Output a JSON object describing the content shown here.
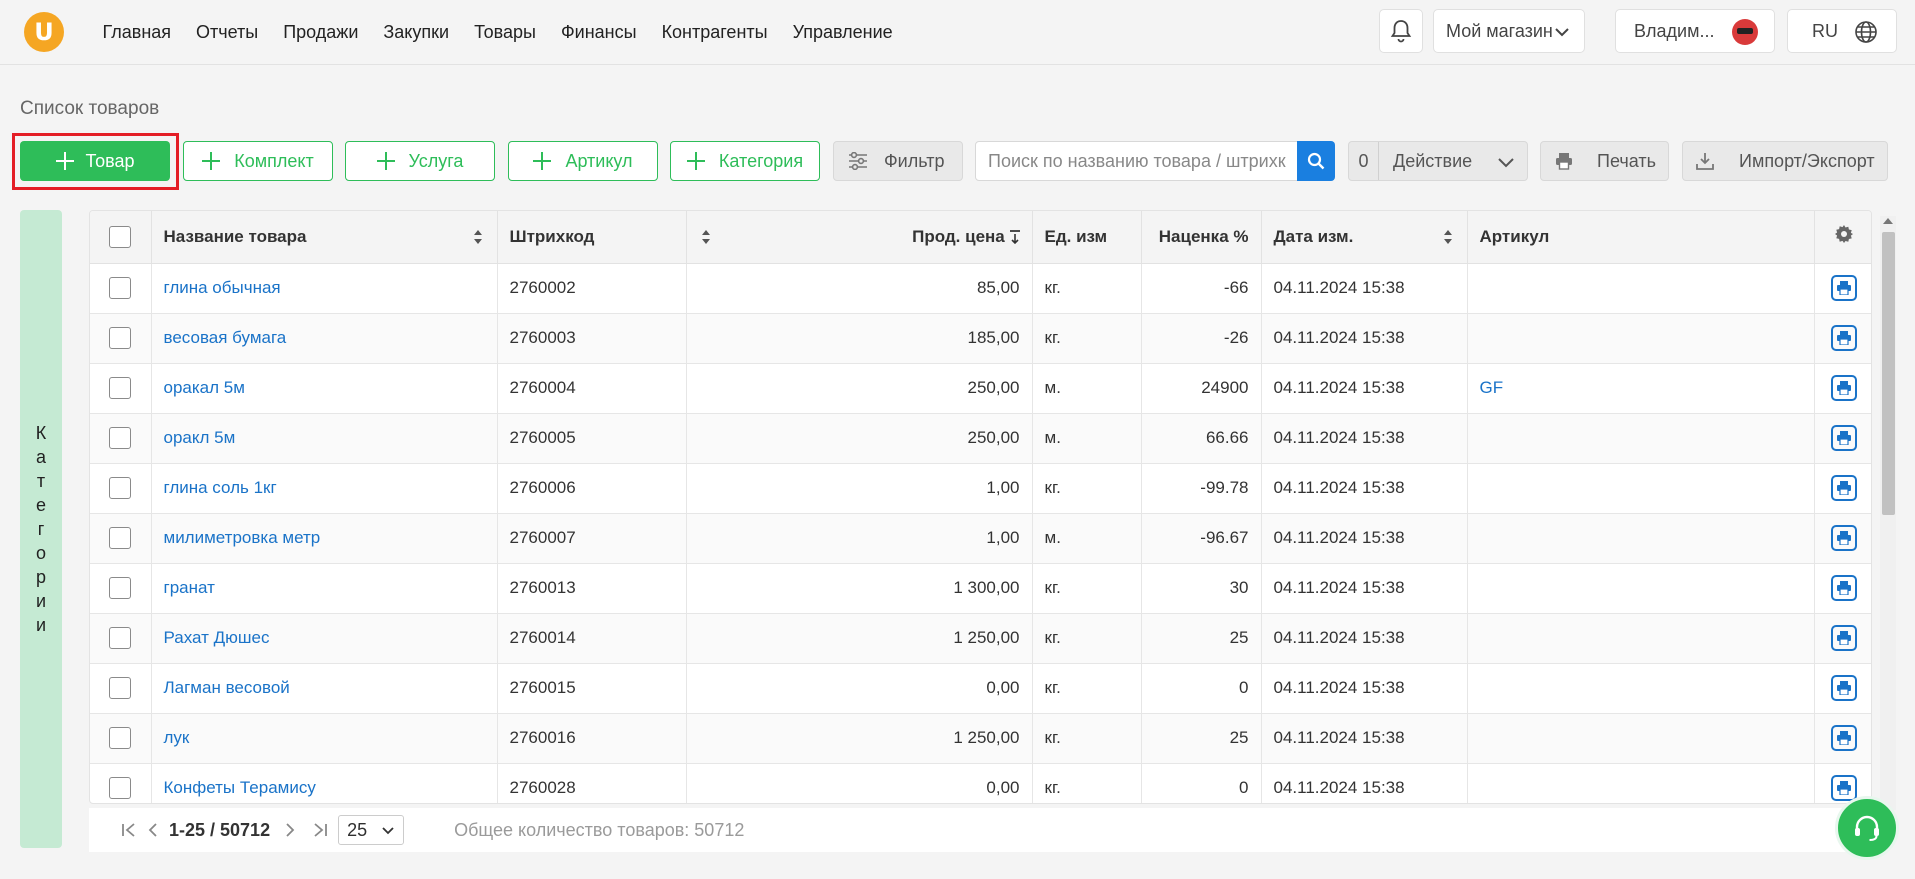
{
  "nav": {
    "logo_letter": "U",
    "items": [
      "Главная",
      "Отчеты",
      "Продажи",
      "Закупки",
      "Товары",
      "Финансы",
      "Контрагенты",
      "Управление"
    ]
  },
  "header": {
    "store": "Мой магазин",
    "user": "Владим...",
    "lang": "RU"
  },
  "page": {
    "title": "Список товаров"
  },
  "toolbar": {
    "add_product": "Товар",
    "add_kit": "Комплект",
    "add_service": "Услуга",
    "add_article": "Артикул",
    "add_category": "Категория",
    "filter": "Фильтр",
    "search_placeholder": "Поиск по названию товара / штрихкоду",
    "action_count": "0",
    "action": "Действие",
    "print": "Печать",
    "import_export": "Импорт/Экспорт"
  },
  "sidebar": {
    "letters": [
      "К",
      "а",
      "т",
      "е",
      "г",
      "о",
      "р",
      "и",
      "и"
    ]
  },
  "table": {
    "headers": {
      "name": "Название товара",
      "barcode": "Штрихкод",
      "price": "Прод. цена",
      "unit": "Ед. изм",
      "markup": "Наценка %",
      "date": "Дата изм.",
      "article": "Артикул"
    },
    "rows": [
      {
        "name": "глина обычная",
        "barcode": "2760002",
        "price": "85,00",
        "unit": "кг.",
        "markup": "-66",
        "date": "04.11.2024 15:38",
        "article": ""
      },
      {
        "name": "весовая бумага",
        "barcode": "2760003",
        "price": "185,00",
        "unit": "кг.",
        "markup": "-26",
        "date": "04.11.2024 15:38",
        "article": ""
      },
      {
        "name": "оракал 5м",
        "barcode": "2760004",
        "price": "250,00",
        "unit": "м.",
        "markup": "24900",
        "date": "04.11.2024 15:38",
        "article": "GF"
      },
      {
        "name": "оракл 5м",
        "barcode": "2760005",
        "price": "250,00",
        "unit": "м.",
        "markup": "66.66",
        "date": "04.11.2024 15:38",
        "article": ""
      },
      {
        "name": "глина соль 1кг",
        "barcode": "2760006",
        "price": "1,00",
        "unit": "кг.",
        "markup": "-99.78",
        "date": "04.11.2024 15:38",
        "article": ""
      },
      {
        "name": "милиметровка метр",
        "barcode": "2760007",
        "price": "1,00",
        "unit": "м.",
        "markup": "-96.67",
        "date": "04.11.2024 15:38",
        "article": ""
      },
      {
        "name": "гранат",
        "barcode": "2760013",
        "price": "1 300,00",
        "unit": "кг.",
        "markup": "30",
        "date": "04.11.2024 15:38",
        "article": ""
      },
      {
        "name": "Рахат Дюшес",
        "barcode": "2760014",
        "price": "1 250,00",
        "unit": "кг.",
        "markup": "25",
        "date": "04.11.2024 15:38",
        "article": ""
      },
      {
        "name": "Лагман весовой",
        "barcode": "2760015",
        "price": "0,00",
        "unit": "кг.",
        "markup": "0",
        "date": "04.11.2024 15:38",
        "article": ""
      },
      {
        "name": "лук",
        "barcode": "2760016",
        "price": "1 250,00",
        "unit": "кг.",
        "markup": "25",
        "date": "04.11.2024 15:38",
        "article": ""
      },
      {
        "name": "Конфеты Терамису",
        "barcode": "2760028",
        "price": "0,00",
        "unit": "кг.",
        "markup": "0",
        "date": "04.11.2024 15:38",
        "article": ""
      }
    ]
  },
  "pagination": {
    "range": "1-25 / 50712",
    "page_size": "25",
    "total": "Общее количество товаров: 50712"
  },
  "colors": {
    "accent_green": "#2ebd59",
    "link_blue": "#1a73c8",
    "highlight_red": "#e41e26",
    "logo_orange": "#f5a623"
  }
}
